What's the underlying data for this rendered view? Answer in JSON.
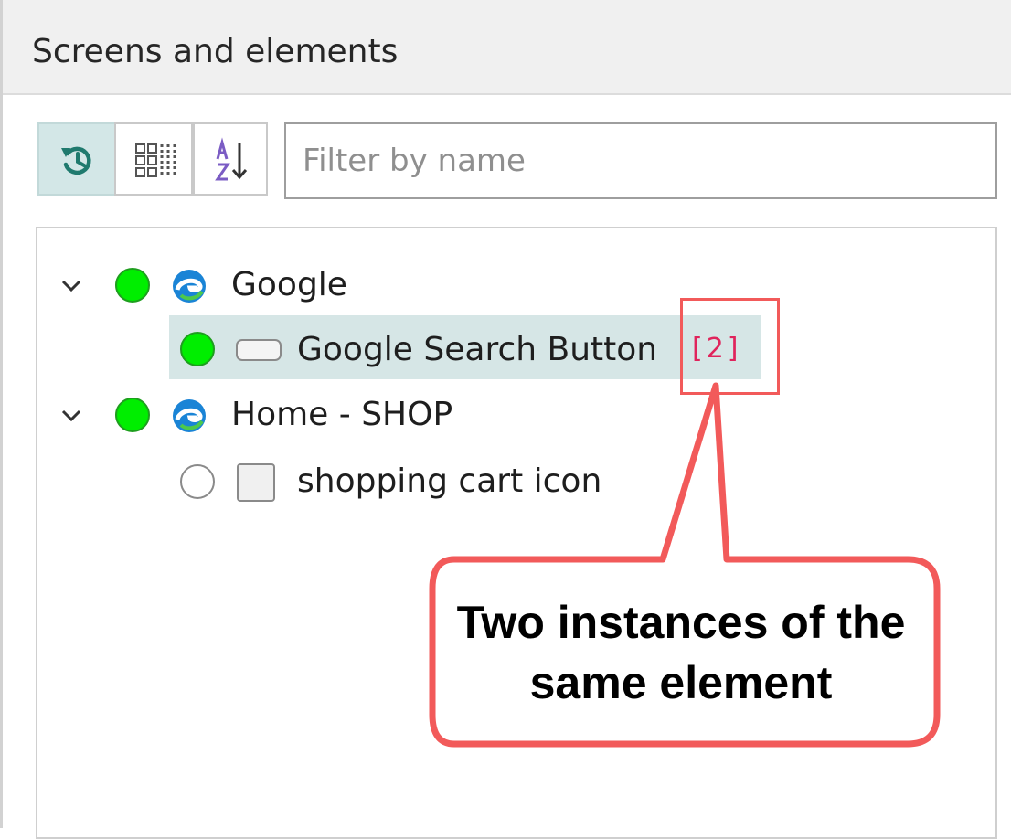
{
  "panel": {
    "title": "Screens and elements"
  },
  "toolbar": {
    "buttons": [
      {
        "icon": "history-icon",
        "active": true
      },
      {
        "icon": "group-grid-icon",
        "active": false
      },
      {
        "icon": "sort-az-icon",
        "active": false
      }
    ],
    "filter": {
      "value": "",
      "placeholder": "Filter by name"
    }
  },
  "tree": {
    "items": [
      {
        "label": "Google",
        "icon": "edge-browser-icon",
        "status": "green",
        "expanded": true,
        "children": [
          {
            "label": "Google Search Button",
            "icon": "button-element-icon",
            "status": "green",
            "selected": true,
            "instance_count": "[2]"
          }
        ]
      },
      {
        "label": "Home - SHOP",
        "icon": "edge-browser-icon",
        "status": "green",
        "expanded": true,
        "children": [
          {
            "label": "shopping cart icon",
            "icon": "image-element-icon",
            "status": "empty",
            "selected": false
          }
        ]
      }
    ]
  },
  "annotation": {
    "text": "Two instances of the same element",
    "color": "#f25a5a"
  },
  "colors": {
    "status_green": "#00ee00",
    "selection": "#d6e6e6",
    "count_badge": "#e0245c"
  }
}
